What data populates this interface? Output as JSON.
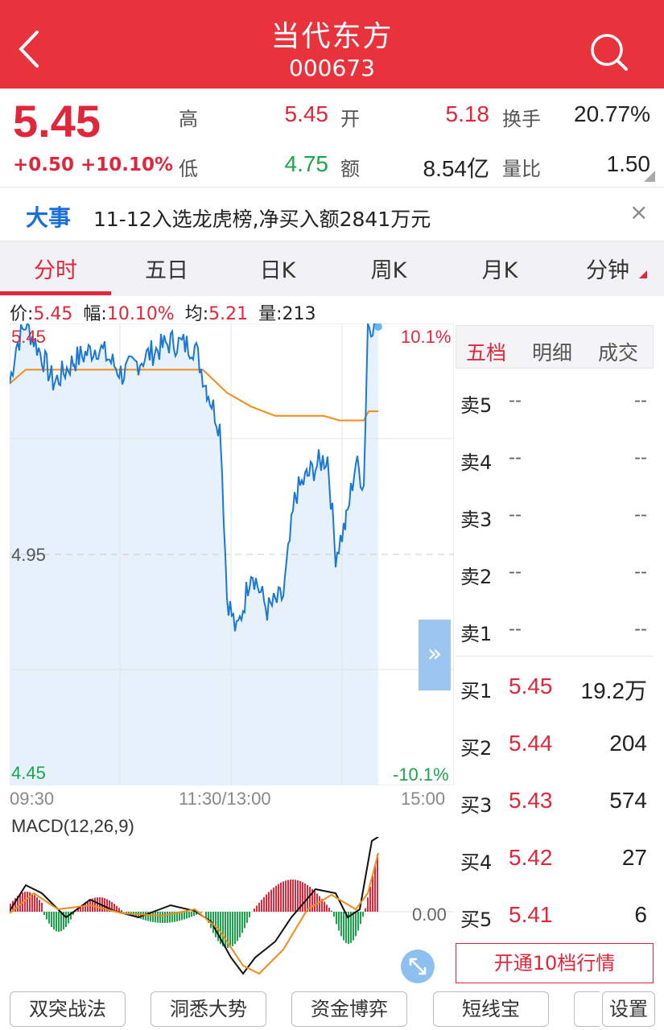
{
  "header": {
    "title": "当代东方",
    "code": "000673"
  },
  "quote": {
    "price": "5.45",
    "change": "+0.50 +10.10%",
    "high_label": "高",
    "high": "5.45",
    "low_label": "低",
    "low": "4.75",
    "open_label": "开",
    "open": "5.18",
    "amount_label": "额",
    "amount": "8.54亿",
    "turnover_label": "换手",
    "turnover": "20.77%",
    "vol_ratio_label": "量比",
    "vol_ratio": "1.50"
  },
  "news": {
    "tag": "大事",
    "text": "11-12入选龙虎榜,净买入额2841万元",
    "close": "×"
  },
  "tabs": [
    {
      "label": "分时",
      "active": true
    },
    {
      "label": "五日"
    },
    {
      "label": "日K"
    },
    {
      "label": "周K"
    },
    {
      "label": "月K"
    },
    {
      "label": "分钟"
    }
  ],
  "infoline": {
    "price_label": "价:",
    "price": "5.45",
    "range_label": "幅:",
    "range": "10.10%",
    "avg_label": "均:",
    "avg": "5.21",
    "vol_label": "量:",
    "vol": "213"
  },
  "intraday": {
    "top_price": "5.45",
    "mid_price": "4.95",
    "bottom_price": "4.45",
    "top_pct": "10.1%",
    "bottom_pct": "-10.1%",
    "time_start": "09:30",
    "time_mid": "11:30/13:00",
    "time_end": "15:00"
  },
  "macd": {
    "title": "MACD(12,26,9)",
    "zero_label": "0.00"
  },
  "orderbook": {
    "tabs": [
      "五档",
      "明细",
      "成交"
    ],
    "asks": [
      {
        "label": "卖5",
        "price": "--",
        "vol": "--"
      },
      {
        "label": "卖4",
        "price": "--",
        "vol": "--"
      },
      {
        "label": "卖3",
        "price": "--",
        "vol": "--"
      },
      {
        "label": "卖2",
        "price": "--",
        "vol": "--"
      },
      {
        "label": "卖1",
        "price": "--",
        "vol": "--"
      }
    ],
    "bids": [
      {
        "label": "买1",
        "price": "5.45",
        "vol": "19.2万"
      },
      {
        "label": "买2",
        "price": "5.44",
        "vol": "204"
      },
      {
        "label": "买3",
        "price": "5.43",
        "vol": "574"
      },
      {
        "label": "买4",
        "price": "5.42",
        "vol": "27"
      },
      {
        "label": "买5",
        "price": "5.41",
        "vol": "6"
      }
    ],
    "open10": "开通10档行情"
  },
  "bottom_buttons": [
    "双突战法",
    "洞悉大势",
    "资金博弈",
    "短线宝",
    "设置"
  ],
  "colors": {
    "header": "#e8333c",
    "up": "#e0263a",
    "down": "#19a64a",
    "price_line": "#1a78d4",
    "avg_line": "#f08c1e"
  }
}
